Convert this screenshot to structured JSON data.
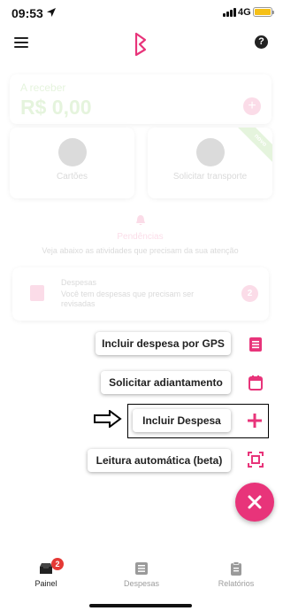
{
  "status_bar": {
    "time": "09:53",
    "network": "4G",
    "battery_color": "#f5c018"
  },
  "header": {
    "menu_icon": "hamburger-icon",
    "logo_icon": "app-logo",
    "help_icon": "help-icon",
    "help_glyph": "?"
  },
  "background": {
    "receivable": {
      "label": "A receber",
      "value": "R$ 0,00",
      "add_glyph": "+"
    },
    "tiles": [
      {
        "label": "Cartões",
        "icon": "card-icon"
      },
      {
        "label": "Solicitar transporte",
        "icon": "car-icon",
        "ribbon": "novo"
      }
    ],
    "pendencias": {
      "title": "Pendências",
      "subtitle": "Veja abaixo as atividades que precisam da sua atenção"
    },
    "despesas_card": {
      "title": "Despesas",
      "text": "Você tem despesas que precisam ser revisadas",
      "count": "2"
    }
  },
  "fab_menu": {
    "items": [
      {
        "label": "Incluir despesa por GPS",
        "icon": "gps-list-icon"
      },
      {
        "label": "Solicitar adiantamento",
        "icon": "calendar-icon"
      },
      {
        "label": "Incluir Despesa",
        "icon": "plus-icon"
      },
      {
        "label": "Leitura automática (beta)",
        "icon": "scan-icon"
      }
    ],
    "close_icon": "close-icon",
    "highlighted_item": "Incluir Despesa"
  },
  "bottom_nav": {
    "items": [
      {
        "label": "Painel",
        "icon": "dashboard-icon",
        "badge": "2",
        "active": true
      },
      {
        "label": "Despesas",
        "icon": "receipt-icon",
        "active": false
      },
      {
        "label": "Relatórios",
        "icon": "clipboard-icon",
        "active": false
      }
    ]
  },
  "colors": {
    "accent": "#e8347a",
    "success": "#6bbf3a",
    "badge": "#e53935"
  }
}
